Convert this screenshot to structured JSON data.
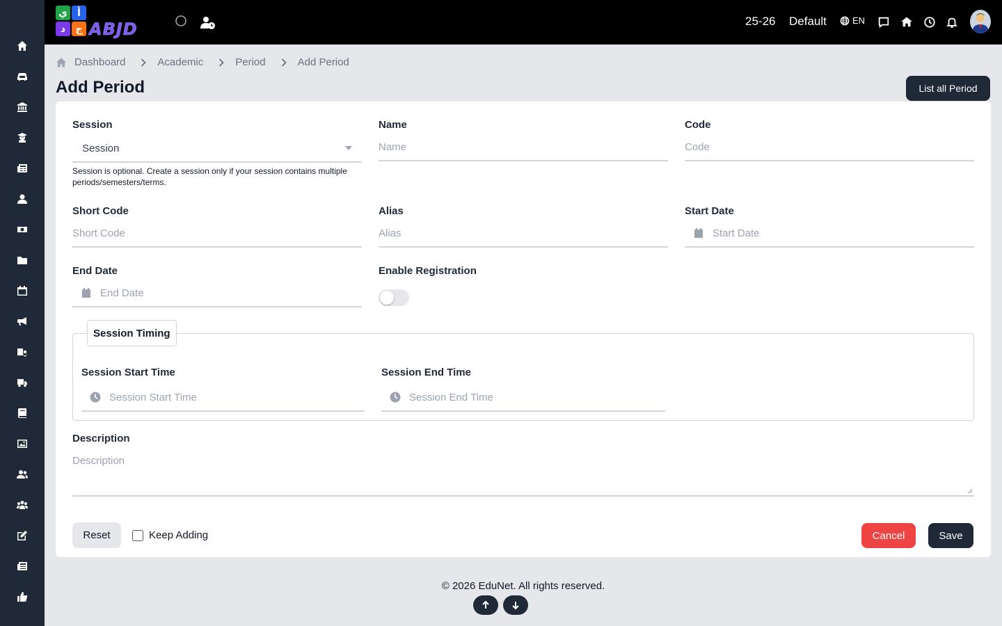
{
  "topbar": {
    "logo_letters": [
      "ي",
      "أ",
      "د",
      "ج"
    ],
    "logo_text": "ABJD",
    "session_year": "25-26",
    "profile": "Default",
    "language": "EN"
  },
  "sidebar": {
    "icons": [
      "home-icon",
      "sofa-icon",
      "institution-icon",
      "graduate-icon",
      "newspaper-icon",
      "user-icon",
      "money-icon",
      "folder-icon",
      "calendar-icon",
      "megaphone-icon",
      "bus-school-icon",
      "truck-icon",
      "book-icon",
      "image-icon",
      "users-icon",
      "group-icon",
      "edit-icon",
      "news-icon",
      "thumbs-up-icon"
    ]
  },
  "breadcrumb": [
    "Dashboard",
    "Academic",
    "Period",
    "Add Period"
  ],
  "page": {
    "title": "Add Period",
    "list_button": "List all Period"
  },
  "form": {
    "session": {
      "label": "Session",
      "value": "Session",
      "help": "Session is optional. Create a session only if your session contains multiple periods/semesters/terms."
    },
    "name": {
      "label": "Name",
      "placeholder": "Name"
    },
    "code": {
      "label": "Code",
      "placeholder": "Code"
    },
    "short_code": {
      "label": "Short Code",
      "placeholder": "Short Code"
    },
    "alias": {
      "label": "Alias",
      "placeholder": "Alias"
    },
    "start_date": {
      "label": "Start Date",
      "placeholder": "Start Date"
    },
    "end_date": {
      "label": "End Date",
      "placeholder": "End Date"
    },
    "enable_registration": {
      "label": "Enable Registration",
      "checked": false
    },
    "session_timing": {
      "legend": "Session Timing",
      "start": {
        "label": "Session Start Time",
        "placeholder": "Session Start Time"
      },
      "end": {
        "label": "Session End Time",
        "placeholder": "Session End Time"
      }
    },
    "description": {
      "label": "Description",
      "placeholder": "Description"
    },
    "actions": {
      "reset": "Reset",
      "keep_adding": "Keep Adding",
      "cancel": "Cancel",
      "save": "Save"
    }
  },
  "footer": {
    "copyright": "© 2026 EduNet. All rights reserved."
  },
  "colors": {
    "primary": "#1f2937",
    "danger": "#ef4444",
    "topbar": "#000000",
    "background": "#e5e7eb"
  }
}
